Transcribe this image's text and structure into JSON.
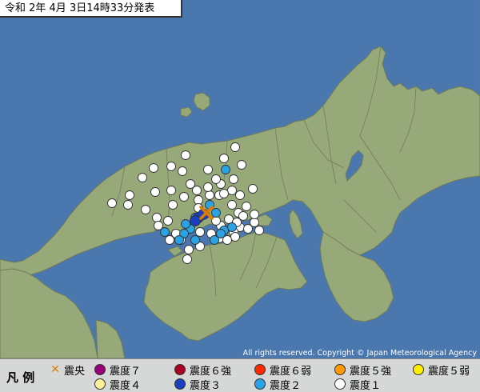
{
  "header": {
    "title": "令和 2年 4月 3日14時33分発表"
  },
  "copyright": "All rights reserved. Copyright © Japan Meteorological Agency",
  "legend": {
    "title": "凡 例",
    "epicenter_label": "震央",
    "items": [
      {
        "label": "震度７",
        "color": "#990077"
      },
      {
        "label": "震度６強",
        "color": "#aa0022"
      },
      {
        "label": "震度６弱",
        "color": "#ff2a00"
      },
      {
        "label": "震度５強",
        "color": "#ff9900"
      },
      {
        "label": "震度５弱",
        "color": "#ffee00"
      },
      {
        "label": "震度４",
        "color": "#ffee99"
      },
      {
        "label": "震度３",
        "color": "#1a3fc0"
      },
      {
        "label": "震度２",
        "color": "#2aa3e6"
      },
      {
        "label": "震度１",
        "color": "#ffffff"
      }
    ]
  },
  "colors": {
    "sea": "#4a78ae",
    "land": "#98a979",
    "border": "#6e7c5a",
    "epicenter": "#e07a00"
  },
  "map": {
    "stations": [
      {
        "intensity": 1
      },
      {
        "intensity": 1
      },
      {
        "intensity": 1
      },
      {
        "intensity": 1
      },
      {
        "intensity": 1
      },
      {
        "intensity": 1
      },
      {
        "intensity": 1
      },
      {
        "intensity": 1
      },
      {
        "intensity": 1
      },
      {
        "intensity": 1
      },
      {
        "intensity": 1
      },
      {
        "intensity": 1
      },
      {
        "intensity": 1
      },
      {
        "intensity": 1
      },
      {
        "intensity": 1
      },
      {
        "intensity": 1
      },
      {
        "intensity": 1
      },
      {
        "intensity": 1
      },
      {
        "intensity": 1
      },
      {
        "intensity": 1
      },
      {
        "intensity": 1
      },
      {
        "intensity": 1
      },
      {
        "intensity": 1
      },
      {
        "intensity": 1
      },
      {
        "intensity": 1
      },
      {
        "intensity": 1
      },
      {
        "intensity": 1
      },
      {
        "intensity": 1
      },
      {
        "intensity": 1
      },
      {
        "intensity": 1
      },
      {
        "intensity": 1
      },
      {
        "intensity": 1
      },
      {
        "intensity": 1
      },
      {
        "intensity": 1
      },
      {
        "intensity": 1
      },
      {
        "intensity": 1
      },
      {
        "intensity": 1
      },
      {
        "intensity": 1
      },
      {
        "intensity": 1
      },
      {
        "intensity": 1
      },
      {
        "intensity": 1
      },
      {
        "intensity": 1
      },
      {
        "intensity": 1
      },
      {
        "intensity": 1
      },
      {
        "intensity": 1
      },
      {
        "intensity": 1
      },
      {
        "intensity": 1
      },
      {
        "intensity": 1
      },
      {
        "intensity": 1
      },
      {
        "intensity": 1
      },
      {
        "intensity": 1
      },
      {
        "intensity": 1
      },
      {
        "intensity": 1
      },
      {
        "intensity": 1
      },
      {
        "intensity": 1
      },
      {
        "intensity": 1
      },
      {
        "intensity": 1
      },
      {
        "intensity": 1
      },
      {
        "intensity": 1
      },
      {
        "intensity": 1
      },
      {
        "intensity": 2
      },
      {
        "intensity": 2
      },
      {
        "intensity": 2
      },
      {
        "intensity": 2
      },
      {
        "intensity": 2
      },
      {
        "intensity": 2
      },
      {
        "intensity": 2
      },
      {
        "intensity": 2
      },
      {
        "intensity": 2
      },
      {
        "intensity": 2
      },
      {
        "intensity": 2
      },
      {
        "intensity": 2
      },
      {
        "intensity": 2
      },
      {
        "intensity": 2
      },
      {
        "intensity": 3
      },
      {
        "intensity": 3
      },
      {
        "intensity": 3
      }
    ]
  }
}
